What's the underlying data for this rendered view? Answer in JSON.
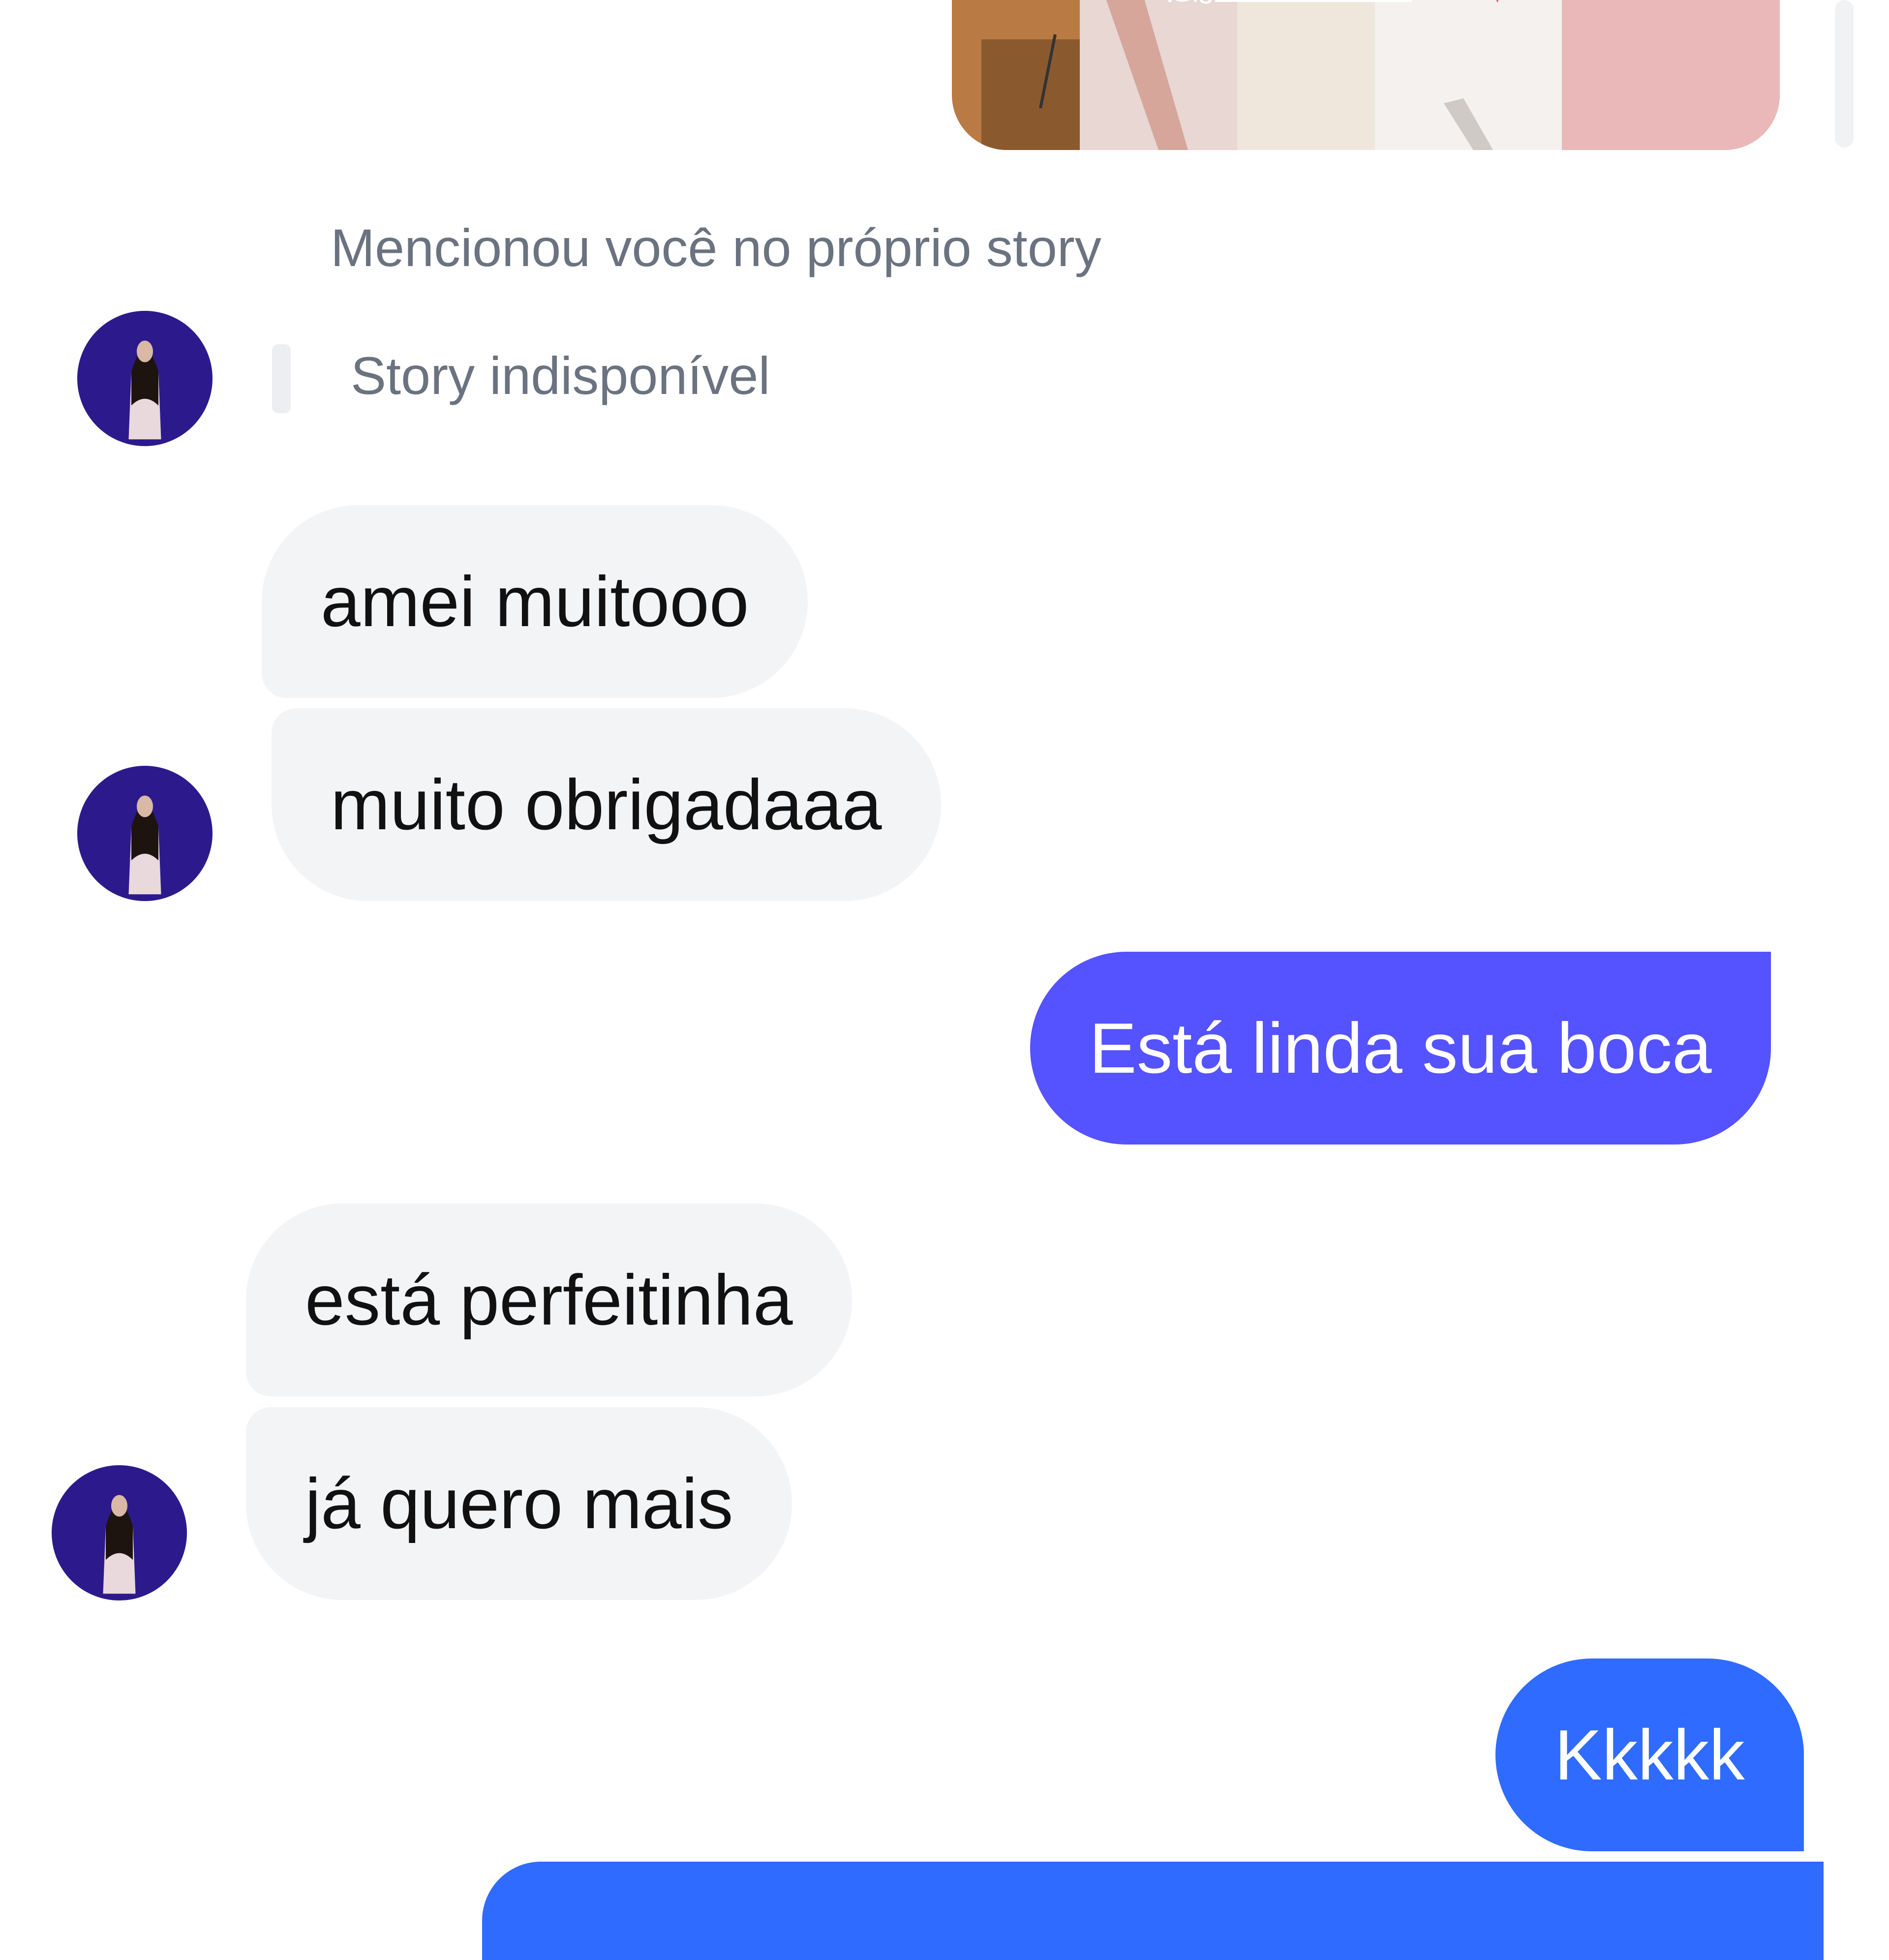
{
  "story": {
    "caption": "@giovannabastosx",
    "heart_icon": "heart-icon"
  },
  "story_notice": "Mencionou você no próprio story",
  "story_unavailable": "Story indisponível",
  "colors": {
    "incoming_bubble": "#f3f4f6",
    "outgoing_purple": "#5552ff",
    "outgoing_blue": "#2f6bff",
    "meta_text": "#6b7280",
    "avatar_bg": "#2c1a8c"
  },
  "messages": [
    {
      "direction": "in",
      "text": "amei muitooo"
    },
    {
      "direction": "in",
      "text": "muito obrigadaaa"
    },
    {
      "direction": "out",
      "text": "Está linda sua boca"
    },
    {
      "direction": "in",
      "text": "está perfeitinha"
    },
    {
      "direction": "in",
      "text": "já quero mais"
    },
    {
      "direction": "out",
      "text": "Kkkkk"
    }
  ]
}
